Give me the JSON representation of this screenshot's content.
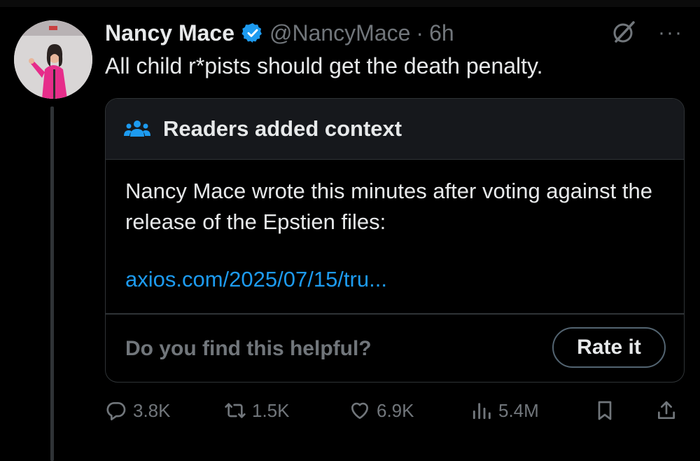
{
  "tweet": {
    "display_name": "Nancy Mace",
    "handle": "@NancyMace",
    "separator": "·",
    "time": "6h",
    "more": "···",
    "text": "All child r*pists should get the death penalty."
  },
  "note": {
    "title": "Readers added context",
    "body": "Nancy Mace wrote this minutes after voting against the release of the Epstien files:",
    "link": "axios.com/2025/07/15/tru...",
    "question": "Do you find this helpful?",
    "rate_label": "Rate it"
  },
  "actions": {
    "replies": "3.8K",
    "reposts": "1.5K",
    "likes": "6.9K",
    "views": "5.4M"
  },
  "colors": {
    "background": "#000000",
    "text": "#e7e9ea",
    "secondary": "#71767b",
    "accent": "#1d9bf0",
    "border": "#2f3336"
  },
  "icons": [
    "verified-badge-icon",
    "grok-icon",
    "more-icon",
    "readers-people-icon",
    "reply-icon",
    "repost-icon",
    "like-icon",
    "views-icon",
    "bookmark-icon",
    "share-icon"
  ]
}
